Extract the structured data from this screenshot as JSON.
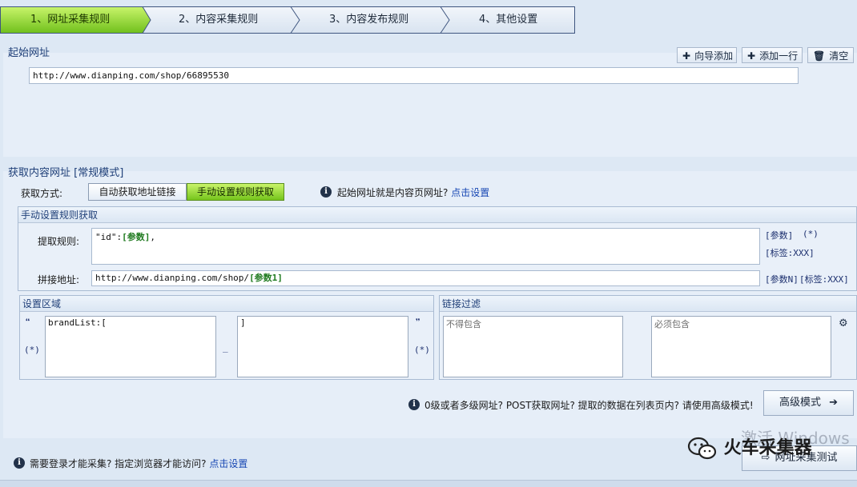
{
  "wizard": {
    "steps": [
      {
        "label": "1、网址采集规则"
      },
      {
        "label": "2、内容采集规则"
      },
      {
        "label": "3、内容发布规则"
      },
      {
        "label": "4、其他设置"
      }
    ]
  },
  "start_url_section": {
    "title": "起始网址",
    "buttons": {
      "wizard_add": "向导添加",
      "add_row": "添加一行",
      "clear": "清空"
    },
    "url_value": "http://www.dianping.com/shop/66895530"
  },
  "content_url_section": {
    "title": "获取内容网址 [常规模式]",
    "method_label": "获取方式:",
    "method_options": [
      "自动获取地址链接",
      "手动设置规则获取"
    ],
    "selected_method": "手动设置规则获取",
    "hint_text": "起始网址就是内容页网址?",
    "hint_link": "点击设置",
    "manual_group": {
      "title": "手动设置规则获取",
      "extract_label": "提取规则:",
      "extract_prefix": "\"id\":",
      "extract_param": "[参数]",
      "extract_suffix": ",",
      "extract_tags": {
        "param": "[参数]",
        "star": "(*)",
        "tag": "[标签:XXX]"
      },
      "join_label": "拼接地址:",
      "join_prefix": "http://www.dianping.com/shop/",
      "join_param": "[参数1]",
      "join_tags": {
        "paramN": "[参数N]",
        "tag": "[标签:XXX]"
      }
    },
    "region_group": {
      "title": "设置区域",
      "open_quote": "❝",
      "close_quote": "❞",
      "star_left": "(*)",
      "star_right": "(*)",
      "start_value": "brandList:[",
      "end_value": "]",
      "separator": "_"
    },
    "filter_group": {
      "title": "链接过滤",
      "exclude_placeholder": "不得包含",
      "include_placeholder": "必须包含"
    },
    "advanced_hint": "0级或者多级网址? POST获取网址? 提取的数据在列表页内? 请使用高级模式!",
    "advanced_button": "高级模式"
  },
  "footer": {
    "login_hint": "需要登录才能采集? 指定浏览器才能访问?",
    "login_link": "点击设置",
    "test_button": "网址采集测试",
    "watermark": "激活 Windows",
    "brand": "火车采集器"
  },
  "colors": {
    "active_step": "#8fd62f",
    "accent_blue": "#1f3f78",
    "link": "#1747b3"
  }
}
